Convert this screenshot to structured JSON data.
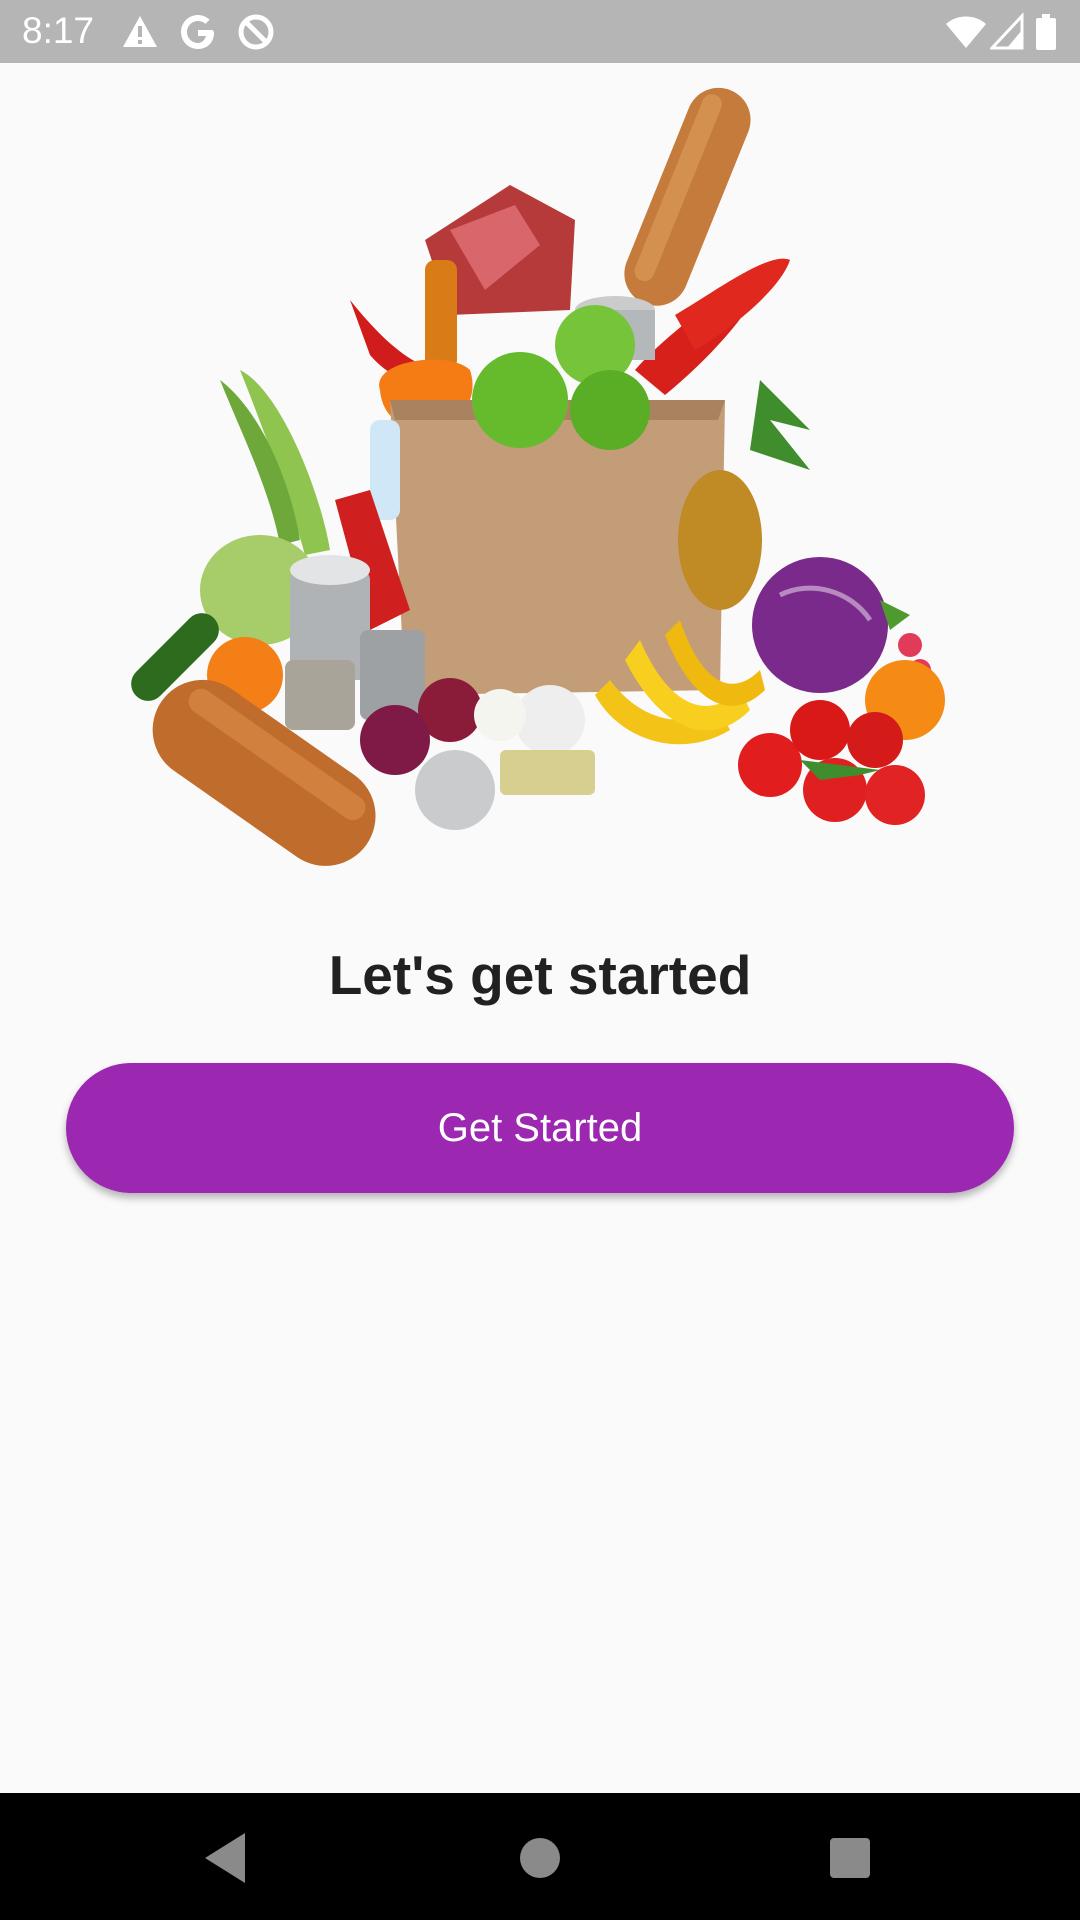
{
  "status_bar": {
    "time": "8:17",
    "left_icons": [
      "warning-icon",
      "google-g-icon",
      "data-saver-icon"
    ],
    "right_icons": [
      "wifi-icon",
      "cell-signal-icon",
      "battery-icon"
    ],
    "background": "#b5b5b5"
  },
  "hero": {
    "image": "grocery-bag-illustration"
  },
  "onboarding": {
    "heading": "Let's get started",
    "cta_label": "Get Started",
    "cta_color": "#9c27b0"
  },
  "nav_bar": {
    "buttons": [
      "back-icon",
      "home-icon",
      "recents-icon"
    ]
  }
}
